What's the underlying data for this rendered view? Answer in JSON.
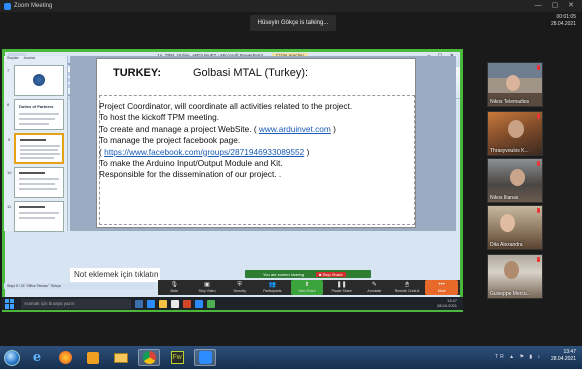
{
  "zoom": {
    "window_title": "Zoom Meeting",
    "talking": "Hüseyin Gökçe is talking...",
    "top_right_time": "00:01:05",
    "top_right_date": "28.04.2021"
  },
  "ppt": {
    "window_title": "1a_TPM_Online_ARDUinvET - Microsoft PowerPoint",
    "context_tab": "Çizim Araçları",
    "tabs": [
      "Giriş",
      "Ekle",
      "Tasarım",
      "Animasyonlar",
      "Slayt Gösterisi",
      "Gözden Geçir",
      "Görünüm",
      "Biçim"
    ],
    "ribbon_groups": [
      "Pano",
      "Slaytlar",
      "Yazı Tipi",
      "Paragraf",
      "Çizim",
      "Düzenleme"
    ],
    "panel_tabs": [
      "Slaytlar",
      "Anahat"
    ],
    "thumbnails": [
      {
        "num": "7",
        "title": ""
      },
      {
        "num": "8",
        "title": "Duties of Partners"
      },
      {
        "num": "9",
        "title": ""
      },
      {
        "num": "10",
        "title": ""
      },
      {
        "num": "11",
        "title": ""
      }
    ],
    "notes_placeholder": "Not eklemek için tıklatın",
    "status": "Slayt 9 / 24   \"Office Teması\"   Türkçe"
  },
  "slide": {
    "country": "TURKEY:",
    "school": "Golbasi MTAL (Turkey):",
    "lines": [
      {
        "pre": "Project Coordinator, will coordinate all activities related to the project.",
        "link": "",
        "post": ""
      },
      {
        "pre": "To host the  kickoff  TPM meeting.",
        "link": "",
        "post": ""
      },
      {
        "pre": "To create and manage a project WebSite. ( ",
        "link": "www.arduinvet.com",
        "post": " )"
      },
      {
        "pre": "To manage the project facebook page.",
        "link": "",
        "post": ""
      },
      {
        "pre": " ( ",
        "link": "https://www.facebook.com/groups/2871946933089552",
        "post": " )"
      },
      {
        "pre": "To make the Arduino Input/Output Module and Kit.",
        "link": "",
        "post": ""
      },
      {
        "pre": " Responsible for the dissemination of our project. .",
        "link": "",
        "post": ""
      }
    ]
  },
  "sharing": {
    "label": "You are screen sharing",
    "stop": "■ Stop Share"
  },
  "sharebar": [
    "Mute",
    "Stop Video",
    "Security",
    "Participants",
    "New Share",
    "Pause Share",
    "Annotate",
    "Remote Control",
    "More"
  ],
  "inner_taskbar": {
    "search": "Aramak için buraya yazın",
    "time": "13:47",
    "date": "28.04.2021"
  },
  "participants": [
    {
      "name": "Nikos Telemadios"
    },
    {
      "name": "Thrasyvoulos K..."
    },
    {
      "name": "Nikos Ilianas"
    },
    {
      "name": "Dita Alexandra"
    },
    {
      "name": "Guiseppe Mercu..."
    }
  ],
  "os_taskbar": {
    "lang": "TR",
    "time": "13:47",
    "date": "28.04.2021"
  },
  "colors": {
    "share_border": "#4ab83a",
    "link": "#1a5bb8",
    "stop": "#d32f2f",
    "more": "#e86a2a"
  }
}
